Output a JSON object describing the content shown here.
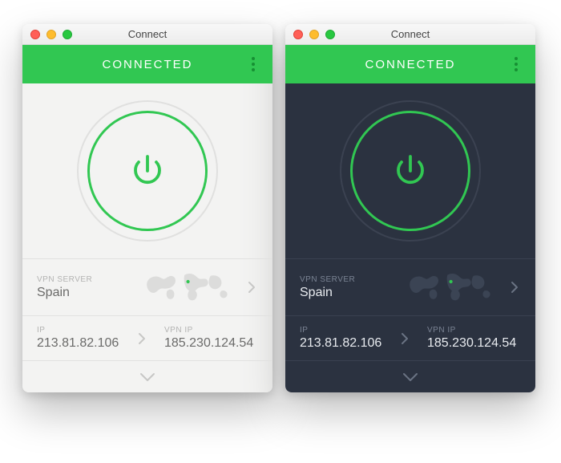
{
  "windows": [
    {
      "id": "light",
      "title": "Connect",
      "status": "CONNECTED",
      "server_label": "VPN SERVER",
      "server_value": "Spain",
      "ip_label": "IP",
      "ip_value": "213.81.82.106",
      "vpnip_label": "VPN IP",
      "vpnip_value": "185.230.124.54"
    },
    {
      "id": "dark",
      "title": "Connect",
      "status": "CONNECTED",
      "server_label": "VPN SERVER",
      "server_value": "Spain",
      "ip_label": "IP",
      "ip_value": "213.81.82.106",
      "vpnip_label": "VPN IP",
      "vpnip_value": "185.230.124.54"
    }
  ]
}
